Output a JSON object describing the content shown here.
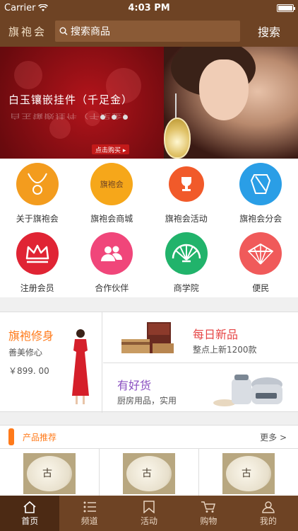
{
  "status_bar": {
    "carrier": "Carrier",
    "time": "4:03 PM"
  },
  "header": {
    "logo": "旗袍会",
    "search_placeholder": "搜索商品",
    "search_button": "搜索"
  },
  "banner": {
    "text": "白玉镶嵌挂件（千足金）",
    "buy_tag": "点击购买 ▸"
  },
  "grid": [
    {
      "label": "关于旗袍会",
      "icon": "necklace-icon",
      "color": "#f39c1e"
    },
    {
      "label": "旗袍会商城",
      "icon": "shop-logo-icon",
      "icon_text": "旗袍会",
      "color": "#f6a71a"
    },
    {
      "label": "旗袍会活动",
      "icon": "trophy-icon",
      "color": "#f15a2a"
    },
    {
      "label": "旗袍会分会",
      "icon": "branch-icon",
      "color": "#2a9ee6"
    },
    {
      "label": "注册会员",
      "icon": "crown-icon",
      "color": "#e02434"
    },
    {
      "label": "合作伙伴",
      "icon": "partners-icon",
      "color": "#f0467a"
    },
    {
      "label": "商学院",
      "icon": "fan-icon",
      "color": "#21b36b"
    },
    {
      "label": "便民",
      "icon": "umbrella-icon",
      "color": "#f05a5a"
    }
  ],
  "promo": {
    "left": {
      "title": "旗袍修身",
      "subtitle": "善美修心",
      "price": "￥899. 00"
    },
    "top_right": {
      "title": "每日新品",
      "subtitle": "整点上新1200款"
    },
    "bottom_right": {
      "title": "有好货",
      "subtitle": "厨房用品，实用"
    }
  },
  "section": {
    "title": "产品推荐",
    "more": "更多 >"
  },
  "products": [
    {
      "label": "古"
    },
    {
      "label": "古"
    },
    {
      "label": "古"
    }
  ],
  "tabs": [
    {
      "label": "首页",
      "icon": "home-icon",
      "active": true
    },
    {
      "label": "频道",
      "icon": "list-icon",
      "active": false
    },
    {
      "label": "活动",
      "icon": "bookmark-icon",
      "active": false
    },
    {
      "label": "购物",
      "icon": "cart-icon",
      "active": false
    },
    {
      "label": "我的",
      "icon": "user-icon",
      "active": false
    }
  ]
}
